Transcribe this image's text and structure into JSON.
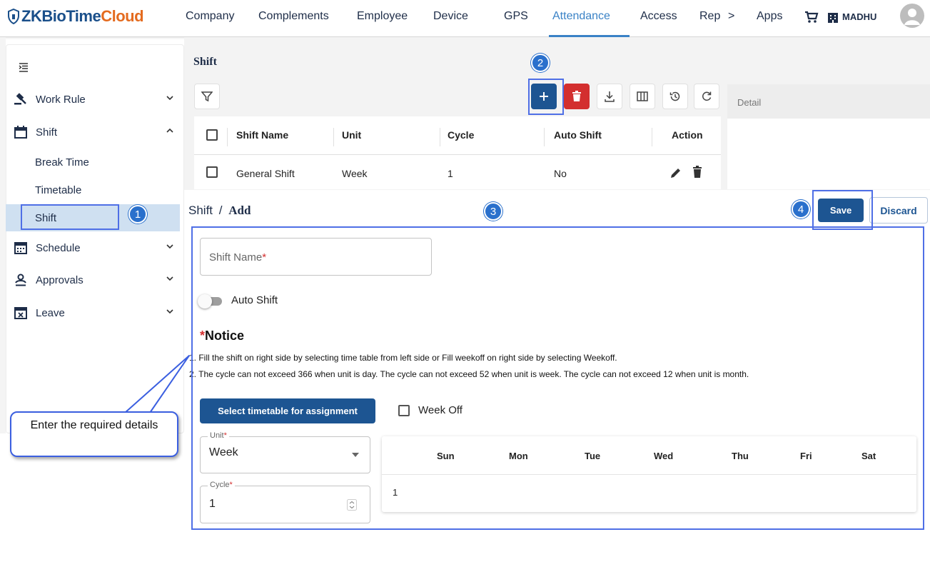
{
  "app": {
    "logo_zk": "ZKBioTime",
    "logo_cloud": "Cloud"
  },
  "nav": {
    "items": [
      "Company",
      "Complements",
      "Employee",
      "Device",
      "GPS",
      "Attendance",
      "Access",
      "Rep",
      "Apps"
    ],
    "more": ">",
    "active": "Attendance",
    "user": "MADHU"
  },
  "sidebar": {
    "sections": [
      {
        "label": "Work Rule",
        "icon": "gavel-icon",
        "expanded": false
      },
      {
        "label": "Shift",
        "icon": "calendar-icon",
        "expanded": true
      },
      {
        "label": "Schedule",
        "icon": "calendar-grid-icon",
        "expanded": false
      },
      {
        "label": "Approvals",
        "icon": "person-check-icon",
        "expanded": false
      },
      {
        "label": "Leave",
        "icon": "calendar-x-icon",
        "expanded": false
      }
    ],
    "sub_items": [
      "Break Time",
      "Timetable",
      "Shift"
    ],
    "active_sub": "Shift"
  },
  "list": {
    "title": "Shift",
    "columns": [
      "Shift Name",
      "Unit",
      "Cycle",
      "Auto Shift",
      "Action"
    ],
    "rows": [
      {
        "name": "General Shift",
        "unit": "Week",
        "cycle": "1",
        "auto": "No"
      }
    ]
  },
  "detail": {
    "title": "Detail"
  },
  "form": {
    "crumb_root": "Shift",
    "crumb_sep": "/",
    "crumb_page": "Add",
    "save": "Save",
    "discard": "Discard",
    "shift_name_placeholder": "Shift Name",
    "required_mark": "*",
    "auto_shift_label": "Auto Shift",
    "auto_shift_on": false,
    "notice_title": "Notice",
    "notice_lines": [
      "1. Fill the shift on right side by selecting time table from left side or Fill weekoff on right side by selecting Weekoff.",
      "2. The cycle can not exceed 366 when unit is day. The cycle can not exceed 52 when unit is week. The cycle can not exceed 12 when unit is month."
    ],
    "select_timetable": "Select timetable for assignment",
    "week_off": "Week Off",
    "unit_label": "Unit",
    "unit_value": "Week",
    "cycle_label": "Cycle",
    "cycle_value": "1",
    "week_days": [
      "Sun",
      "Mon",
      "Tue",
      "Wed",
      "Thu",
      "Fri",
      "Sat"
    ],
    "week_rows": [
      "1"
    ]
  },
  "annotations": {
    "badges": [
      "1",
      "2",
      "3",
      "4"
    ],
    "callout": "Enter the required details",
    "highlight_color": "#4f6fe6",
    "badge_color": "#2a70cc"
  },
  "colors": {
    "primary": "#1d5592",
    "danger": "#d32f2f",
    "accent": "#3a82c6",
    "brand_orange": "#e46b1f"
  }
}
